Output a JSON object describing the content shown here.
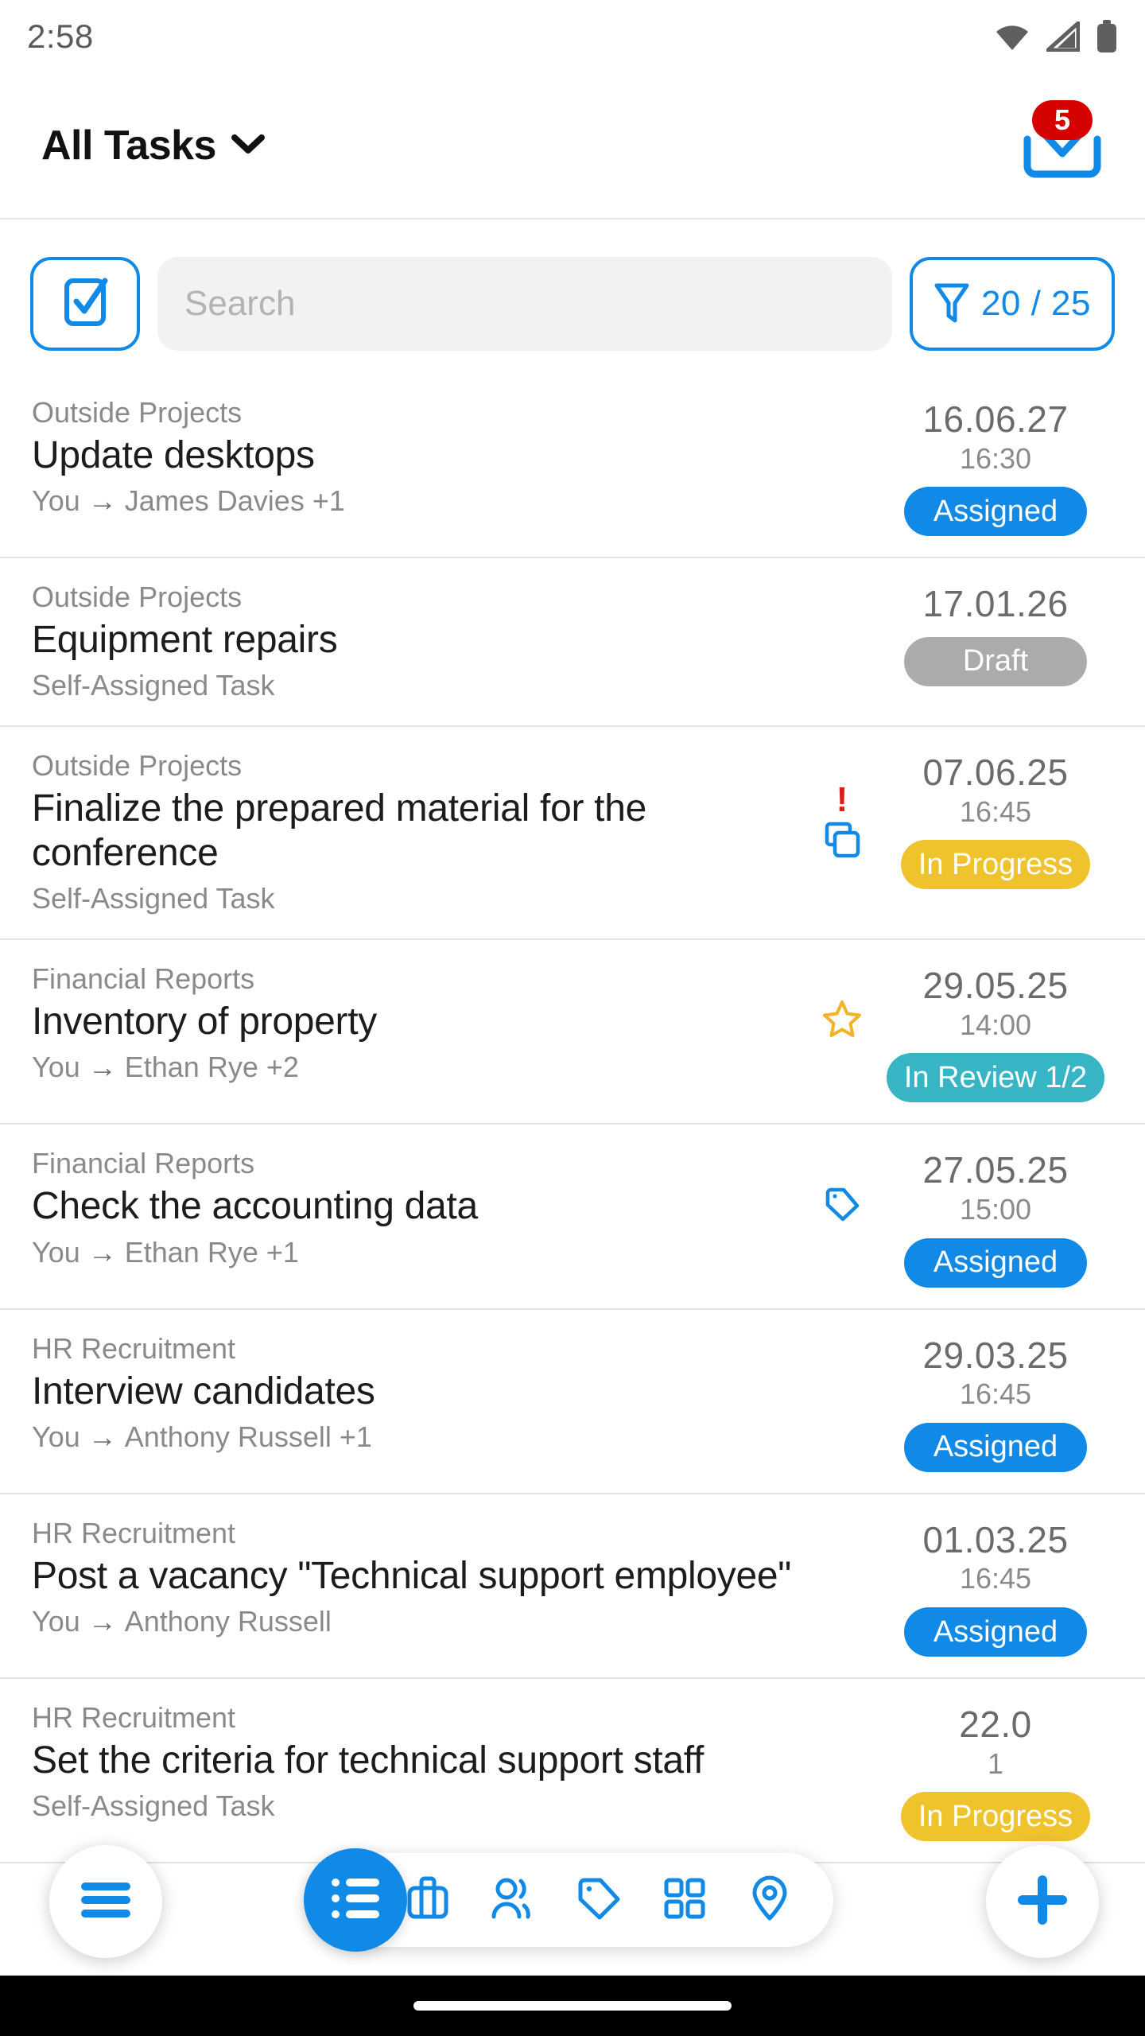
{
  "statusbar": {
    "time": "2:58",
    "icons": [
      "wifi-icon",
      "cellular-signal-icon",
      "battery-icon"
    ]
  },
  "header": {
    "title": "All Tasks",
    "dropdown_icon": "chevron-down-icon",
    "inbox_icon": "inbox-tray-icon",
    "inbox_badge": "5"
  },
  "toolbar": {
    "select_icon": "checkbox-select-icon",
    "search_placeholder": "Search",
    "search_value": "",
    "filter_icon": "filter-funnel-icon",
    "filter_label": "20 / 25"
  },
  "colors": {
    "accent_blue": "#1189E6",
    "status_assigned": "#1189E6",
    "status_draft": "#ABABAB",
    "status_in_progress": "#EFC32C",
    "status_in_review": "#37B5C4",
    "badge_red": "#D50000",
    "priority_red": "#E01B1B",
    "star_orange": "#F5B225"
  },
  "tasks": [
    {
      "project": "Outside Projects",
      "title": "Update desktops",
      "assignment": "You",
      "assignment_arrow": "→",
      "assignee": "James Davies +1",
      "date": "16.06.27",
      "time": "16:30",
      "status": "Assigned",
      "status_color": "#1189E6",
      "icons": []
    },
    {
      "project": "Outside Projects",
      "title": "Equipment repairs",
      "assignment": "Self-Assigned Task",
      "assignment_arrow": "",
      "assignee": "",
      "date": "17.01.26",
      "time": "",
      "status": "Draft",
      "status_color": "#ABABAB",
      "icons": []
    },
    {
      "project": "Outside Projects",
      "title": "Finalize the prepared material for the conference",
      "assignment": "Self-Assigned Task",
      "assignment_arrow": "",
      "assignee": "",
      "date": "07.06.25",
      "time": "16:45",
      "status": "In Progress",
      "status_color": "#EFC32C",
      "icons": [
        "priority-high-icon",
        "copy-duplicate-icon"
      ]
    },
    {
      "project": "Financial Reports",
      "title": "Inventory of property",
      "assignment": "You",
      "assignment_arrow": "→",
      "assignee": "Ethan Rye +2",
      "date": "29.05.25",
      "time": "14:00",
      "status": "In Review 1/2",
      "status_color": "#37B5C4",
      "icons": [
        "star-icon"
      ]
    },
    {
      "project": "Financial Reports",
      "title": "Check the accounting data",
      "assignment": "You",
      "assignment_arrow": "→",
      "assignee": "Ethan Rye +1",
      "date": "27.05.25",
      "time": "15:00",
      "status": "Assigned",
      "status_color": "#1189E6",
      "icons": [
        "tag-icon"
      ]
    },
    {
      "project": "HR Recruitment",
      "title": "Interview candidates",
      "assignment": "You",
      "assignment_arrow": "→",
      "assignee": "Anthony Russell +1",
      "date": "29.03.25",
      "time": "16:45",
      "status": "Assigned",
      "status_color": "#1189E6",
      "icons": []
    },
    {
      "project": "HR Recruitment",
      "title": "Post a vacancy \"Technical support employee\"",
      "assignment": "You",
      "assignment_arrow": "→",
      "assignee": "Anthony Russell",
      "date": "01.03.25",
      "time": "16:45",
      "status": "Assigned",
      "status_color": "#1189E6",
      "icons": []
    },
    {
      "project": "HR Recruitment",
      "title": "Set the criteria for technical support staff",
      "assignment": "Self-Assigned Task",
      "assignment_arrow": "",
      "assignee": "",
      "date": "22.0",
      "time": "1",
      "status": "In Progress",
      "status_color": "#EFC32C",
      "icons": []
    }
  ],
  "bottomnav": {
    "menu_icon": "hamburger-menu-icon",
    "add_icon": "plus-icon",
    "items": [
      {
        "icon": "list-icon",
        "active": true
      },
      {
        "icon": "briefcase-icon",
        "active": false
      },
      {
        "icon": "contacts-people-icon",
        "active": false
      },
      {
        "icon": "tag-icon",
        "active": false
      },
      {
        "icon": "grid-apps-icon",
        "active": false
      },
      {
        "icon": "location-pin-icon",
        "active": false
      }
    ]
  }
}
